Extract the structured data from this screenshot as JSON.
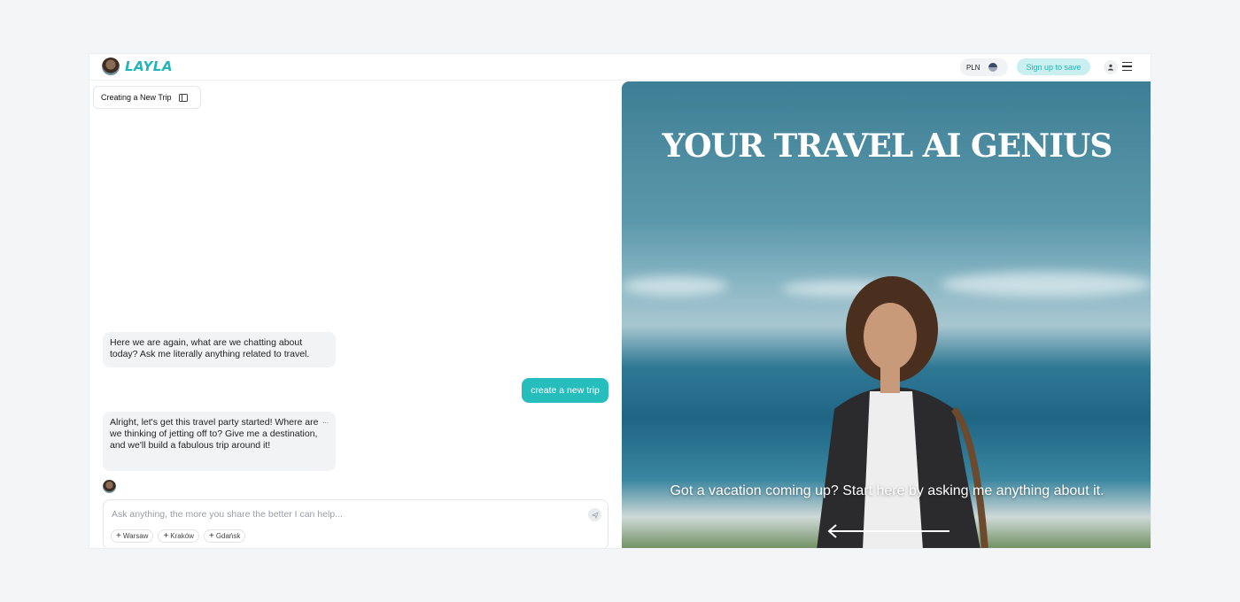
{
  "header": {
    "logo_text": "LAYLA",
    "currency": "PLN",
    "signup_label": "Sign up to save"
  },
  "chat": {
    "tab_title": "Creating a New Trip",
    "messages": [
      {
        "role": "assistant",
        "text": "Here we are again, what are we chatting about today? Ask me literally anything related to travel."
      },
      {
        "role": "user",
        "text": "create a new trip"
      },
      {
        "role": "assistant",
        "text": "Alright, let's get this travel party started! Where are we thinking of jetting off to? Give me a destination, and we'll build a fabulous trip around it!"
      }
    ],
    "more_indicator": "...",
    "input_placeholder": "Ask anything, the more you share the better I can help...",
    "suggestions": [
      "Warsaw",
      "Kraków",
      "Gdańsk"
    ]
  },
  "hero": {
    "title": "YOUR TRAVEL AI GENIUS",
    "subtitle": "Got a vacation coming up? Start here by asking me anything about it."
  },
  "colors": {
    "brand": "#23b5b5",
    "user_bubble": "#26bdbd",
    "signup_bg": "#c9eff0"
  }
}
